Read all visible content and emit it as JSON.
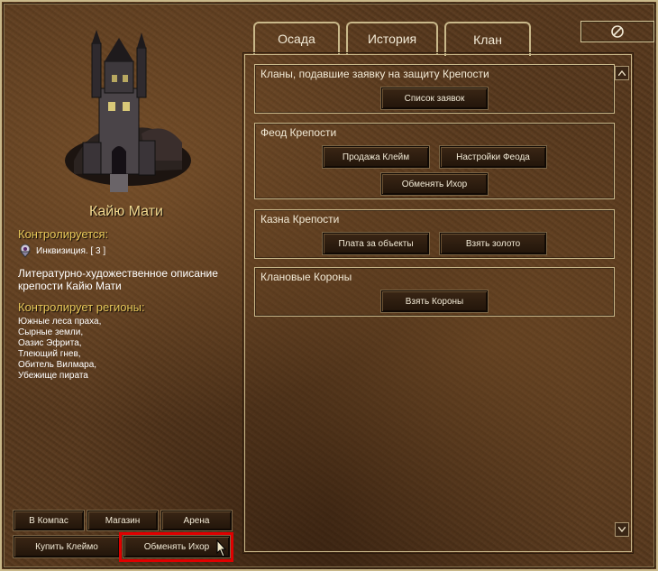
{
  "fortress": {
    "name": "Кайю Мати",
    "controlled_label": "Контролируется:",
    "clan_name": "Инквизиция. [ 3 ]",
    "description": "Литературно-художественное описание крепости Кайю Мати",
    "regions_label": "Контролирует регионы:",
    "regions": [
      "Южные леса праха,",
      "Сырные земли,",
      "Оазис Эфрита,",
      "Тлеющий гнев,",
      "Обитель Вилмара,",
      "Убежище пирата"
    ]
  },
  "left_buttons": {
    "compass": "В Компас",
    "shop": "Магазин",
    "arena": "Арена",
    "buy_brand": "Купить Клеймо",
    "exchange_ichor": "Обменять Ихор"
  },
  "tabs": [
    {
      "label": "Осада",
      "active": false
    },
    {
      "label": "История",
      "active": false
    },
    {
      "label": "Клан",
      "active": true
    }
  ],
  "close_icon": "ban-icon",
  "sections": {
    "applications": {
      "title": "Кланы, подавшие заявку на защиту Крепости",
      "list_button": "Список заявок"
    },
    "feud": {
      "title": "Феод Крепости",
      "sell_brands_button": "Продажа Клейм",
      "feud_settings_button": "Настройки Феода",
      "exchange_ichor_button": "Обменять Ихор"
    },
    "treasury": {
      "title": "Казна Крепости",
      "pay_objects_button": "Плата за объекты",
      "take_gold_button": "Взять золото"
    },
    "crowns": {
      "title": "Клановые Короны",
      "take_crowns_button": "Взять Короны"
    }
  },
  "colors": {
    "gold_text": "#e8c85a",
    "highlight": "#e00000",
    "border": "#c9b88a"
  }
}
